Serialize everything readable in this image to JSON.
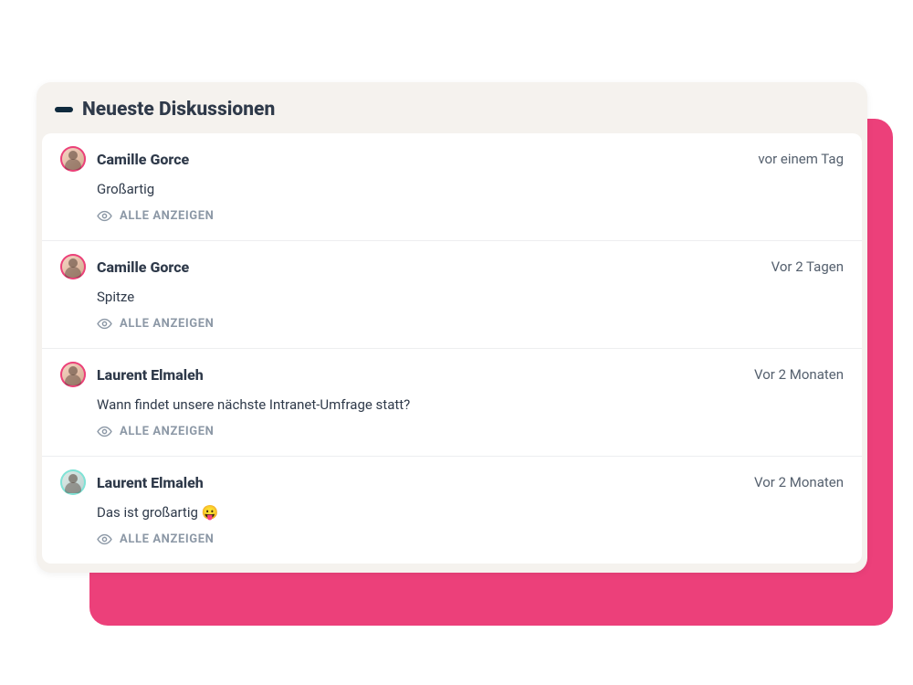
{
  "panel": {
    "title": "Neueste Diskussionen",
    "view_all_label": "ALLE ANZEIGEN"
  },
  "colors": {
    "accent": "#ec407a",
    "panel_bg": "#f5f2ee",
    "text_primary": "#2f3a4a",
    "muted": "#8c98a6"
  },
  "discussions": [
    {
      "author": "Camille Gorce",
      "timestamp": "vor einem Tag",
      "body": "Großartig",
      "avatar_ring": "pink"
    },
    {
      "author": "Camille Gorce",
      "timestamp": "Vor 2 Tagen",
      "body": "Spitze",
      "avatar_ring": "pink"
    },
    {
      "author": "Laurent Elmaleh",
      "timestamp": "Vor 2 Monaten",
      "body": "Wann findet unsere nächste Intranet-Umfrage statt?",
      "avatar_ring": "pink"
    },
    {
      "author": "Laurent Elmaleh",
      "timestamp": "Vor 2 Monaten",
      "body": "Das ist großartig 😛",
      "avatar_ring": "teal"
    }
  ]
}
